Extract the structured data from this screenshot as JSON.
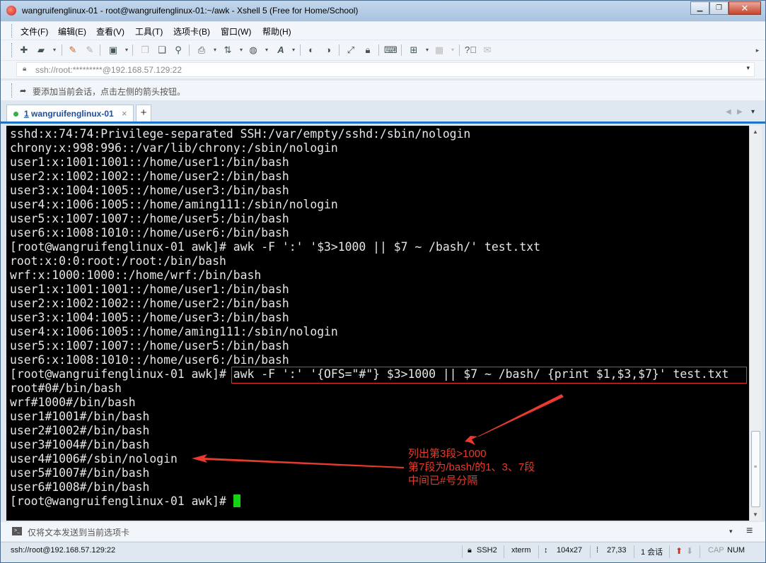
{
  "window": {
    "title": "wangruifenglinux-01 - root@wangruifenglinux-01:~/awk - Xshell 5 (Free for Home/School)",
    "controls": {
      "minimize": "▁",
      "maximize": "❐",
      "close": "✕"
    }
  },
  "menu": [
    "文件(F)",
    "编辑(E)",
    "查看(V)",
    "工具(T)",
    "选项卡(B)",
    "窗口(W)",
    "帮助(H)"
  ],
  "address": {
    "value": "ssh://root:*********@192.168.57.129:22",
    "dropdown": "▾"
  },
  "hint": {
    "text": "要添加当前会话，点击左侧的箭头按钮。"
  },
  "tabs": [
    {
      "number": "1",
      "label": "wangruifenglinux-01",
      "close": "×",
      "status": "connected"
    }
  ],
  "tab_add": "+",
  "tab_nav": {
    "prev": "◀",
    "next": "▶",
    "list": "▾"
  },
  "terminal": {
    "lines": [
      "sshd:x:74:74:Privilege-separated SSH:/var/empty/sshd:/sbin/nologin",
      "chrony:x:998:996::/var/lib/chrony:/sbin/nologin",
      "user1:x:1001:1001::/home/user1:/bin/bash",
      "user2:x:1002:1002::/home/user2:/bin/bash",
      "user3:x:1004:1005::/home/user3:/bin/bash",
      "user4:x:1006:1005::/home/aming111:/sbin/nologin",
      "user5:x:1007:1007::/home/user5:/bin/bash",
      "user6:x:1008:1010::/home/user6:/bin/bash",
      "[root@wangruifenglinux-01 awk]# awk -F ':' '$3>1000 || $7 ~ /bash/' test.txt",
      "root:x:0:0:root:/root:/bin/bash",
      "wrf:x:1000:1000::/home/wrf:/bin/bash",
      "user1:x:1001:1001::/home/user1:/bin/bash",
      "user2:x:1002:1002::/home/user2:/bin/bash",
      "user3:x:1004:1005::/home/user3:/bin/bash",
      "user4:x:1006:1005::/home/aming111:/sbin/nologin",
      "user5:x:1007:1007::/home/user5:/bin/bash",
      "user6:x:1008:1010::/home/user6:/bin/bash",
      "[root@wangruifenglinux-01 awk]# awk -F ':' '{OFS=\"#\"} $3>1000 || $7 ~ /bash/ {print $1,$3,$7}' test.txt",
      "root#0#/bin/bash",
      "wrf#1000#/bin/bash",
      "user1#1001#/bin/bash",
      "user2#1002#/bin/bash",
      "user3#1004#/bin/bash",
      "user4#1006#/sbin/nologin",
      "user5#1007#/bin/bash",
      "user6#1008#/bin/bash"
    ],
    "prompt": "[root@wangruifenglinux-01 awk]# ",
    "annotation": "列出第3段>1000\n第7段为/bash/的1、3、7段\n中间已#号分隔"
  },
  "compose": {
    "placeholder": "仅将文本发送到当前选项卡"
  },
  "status": {
    "connection": "ssh://root@192.168.57.129:22",
    "protocol": "SSH2",
    "terminal_type": "xterm",
    "size": "104x27",
    "cursor_pos": "27,33",
    "sessions": "1 会话",
    "caps": "CAP",
    "num": "NUM"
  },
  "colors": {
    "terminal_bg": "#000000",
    "terminal_fg": "#e6e6e6",
    "cursor": "#13d313",
    "annotation": "#e63b2e",
    "tab_accent": "#1e73c8"
  }
}
